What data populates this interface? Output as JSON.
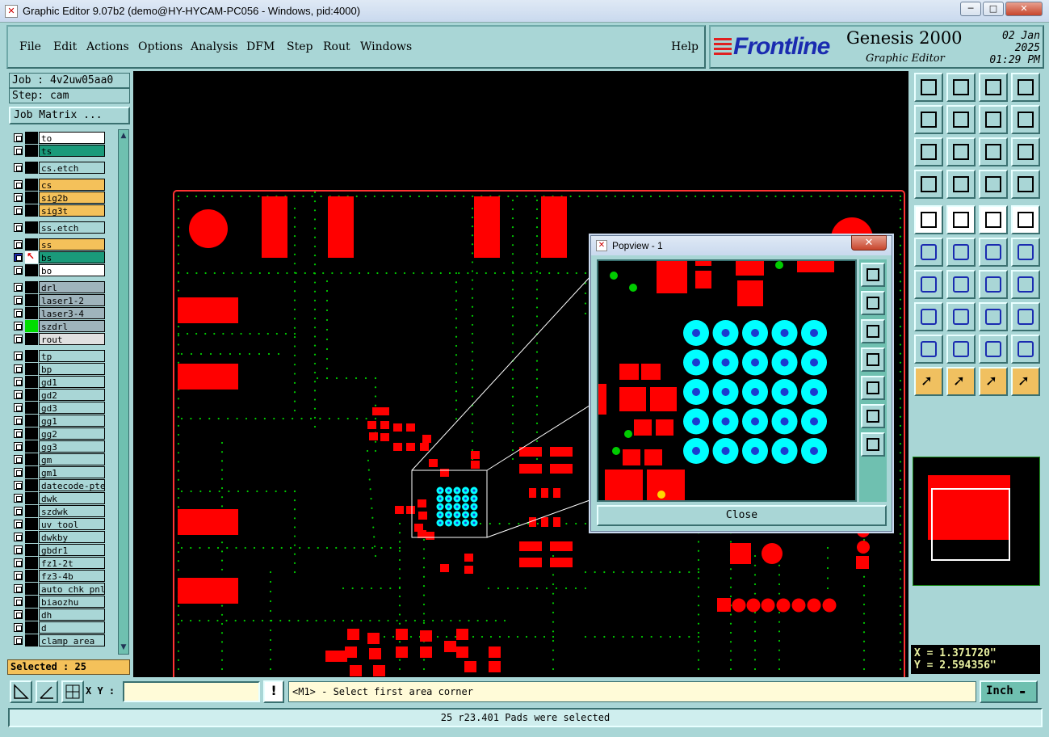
{
  "window": {
    "title": "Graphic Editor 9.07b2 (demo@HY-HYCAM-PC056 - Windows, pid:4000)",
    "minimize": "─",
    "maximize": "□",
    "close": "✕"
  },
  "menubar": {
    "items": [
      "File",
      "Edit",
      "Actions",
      "Options",
      "Analysis",
      "DFM",
      "Step",
      "Rout",
      "Windows"
    ],
    "help": "Help"
  },
  "brand": {
    "logo": "Frontline",
    "product": "Genesis 2000",
    "subtitle": "Graphic Editor",
    "date": "02 Jan 2025",
    "time": "01:29 PM"
  },
  "job": {
    "job_label": "Job : 4v2uw05aa0",
    "step_label": "Step: cam",
    "matrix_button": "Job Matrix ..."
  },
  "layers": [
    {
      "name": "to",
      "color": "#ffffff"
    },
    {
      "name": "ts",
      "color": "#1a9a7a"
    },
    {
      "name": "cs.etch",
      "color": "#a9d6d6"
    },
    {
      "name": "cs",
      "color": "#f4c15a"
    },
    {
      "name": "sig2b",
      "color": "#f4c15a"
    },
    {
      "name": "sig3t",
      "color": "#f4c15a"
    },
    {
      "name": "ss.etch",
      "color": "#a9d6d6"
    },
    {
      "name": "ss",
      "color": "#f4c15a"
    },
    {
      "name": "bs",
      "color": "#1a9a7a"
    },
    {
      "name": "bo",
      "color": "#ffffff"
    },
    {
      "name": "drl",
      "color": "#9fb4bc"
    },
    {
      "name": "laser1-2",
      "color": "#9fb4bc"
    },
    {
      "name": "laser3-4",
      "color": "#9fb4bc"
    },
    {
      "name": "szdrl",
      "color": "#9fb4bc"
    },
    {
      "name": "rout",
      "color": "#e0e0e0"
    },
    {
      "name": "tp",
      "color": "#a9d6d6"
    },
    {
      "name": "bp",
      "color": "#a9d6d6"
    },
    {
      "name": "gd1",
      "color": "#a9d6d6"
    },
    {
      "name": "gd2",
      "color": "#a9d6d6"
    },
    {
      "name": "gd3",
      "color": "#a9d6d6"
    },
    {
      "name": "gg1",
      "color": "#a9d6d6"
    },
    {
      "name": "gg2",
      "color": "#a9d6d6"
    },
    {
      "name": "gg3",
      "color": "#a9d6d6"
    },
    {
      "name": "gm",
      "color": "#a9d6d6"
    },
    {
      "name": "gm1",
      "color": "#a9d6d6"
    },
    {
      "name": "datecode-pte",
      "color": "#a9d6d6"
    },
    {
      "name": "dwk",
      "color": "#a9d6d6"
    },
    {
      "name": "szdwk",
      "color": "#a9d6d6"
    },
    {
      "name": "uv_tool",
      "color": "#a9d6d6"
    },
    {
      "name": "dwkby",
      "color": "#a9d6d6"
    },
    {
      "name": "gbdr1",
      "color": "#a9d6d6"
    },
    {
      "name": "fz1-2t",
      "color": "#a9d6d6"
    },
    {
      "name": "fz3-4b",
      "color": "#a9d6d6"
    },
    {
      "name": "auto_chk_pnl",
      "color": "#a9d6d6"
    },
    {
      "name": "biaozhu",
      "color": "#a9d6d6"
    },
    {
      "name": "dh",
      "color": "#a9d6d6"
    },
    {
      "name": "d",
      "color": "#a9d6d6"
    },
    {
      "name": "clamp_area",
      "color": "#a9d6d6"
    }
  ],
  "selected_count": "Selected : 25",
  "popview": {
    "title": "Popview - 1",
    "close_button": "Close"
  },
  "coords": {
    "x": "X = 1.371720\"",
    "y": "Y = 2.594356\""
  },
  "status": {
    "xy_label": "X Y :",
    "xy_value": "",
    "prompt": "<M1> - Select first area corner",
    "unit": "Inch",
    "message": "25 r23.401 Pads were selected"
  },
  "colors": {
    "pad": "#ff0000",
    "selected_pad": "#00ffff",
    "trace_dots": "#00cc00",
    "board_outline": "#ff3333",
    "ui_bg": "#a9d6d6"
  }
}
